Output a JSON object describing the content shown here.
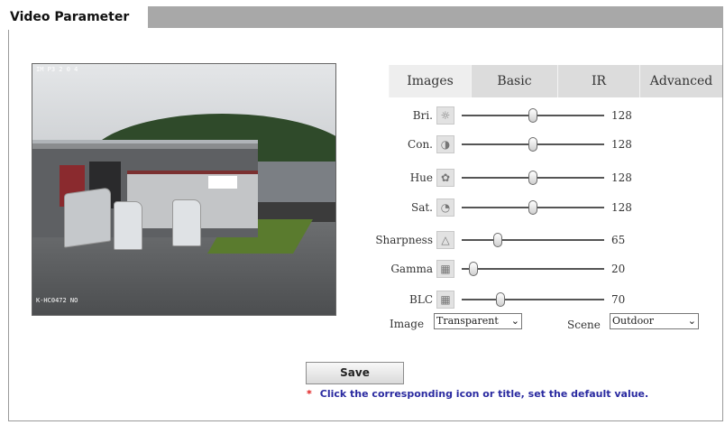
{
  "window": {
    "title": "Video Parameter"
  },
  "preview": {
    "osd_top": "IM P3 2 0 4",
    "osd_bottom": "K-HC0472 NO"
  },
  "tabs": [
    {
      "label": "Images",
      "active": true
    },
    {
      "label": "Basic",
      "active": false
    },
    {
      "label": "IR",
      "active": false
    },
    {
      "label": "Advanced",
      "active": false
    }
  ],
  "params": [
    {
      "label": "Bri.",
      "icon": "brightness-icon",
      "value": "128",
      "level": 0.5
    },
    {
      "label": "Con.",
      "icon": "contrast-icon",
      "value": "128",
      "level": 0.5
    },
    {
      "label": "Hue",
      "icon": "hue-icon",
      "value": "128",
      "level": 0.5
    },
    {
      "label": "Sat.",
      "icon": "saturation-icon",
      "value": "128",
      "level": 0.5
    },
    {
      "label": "Sharpness",
      "icon": "sharpness-icon",
      "value": "65",
      "level": 0.25
    },
    {
      "label": "Gamma",
      "icon": "gamma-icon",
      "value": "20",
      "level": 0.08
    },
    {
      "label": "BLC",
      "icon": "blc-icon",
      "value": "70",
      "level": 0.27
    }
  ],
  "image_select": {
    "label": "Image",
    "value": "Transparent"
  },
  "scene_select": {
    "label": "Scene",
    "value": "Outdoor"
  },
  "save_label": "Save",
  "note": {
    "marker": "*",
    "text": "Click the corresponding icon or title, set the default value."
  },
  "colors": {
    "title_bar": "#a8a8a8",
    "tab_bg": "#dcdcdc",
    "note_text": "#2a2aa0",
    "note_marker": "#e01818"
  }
}
